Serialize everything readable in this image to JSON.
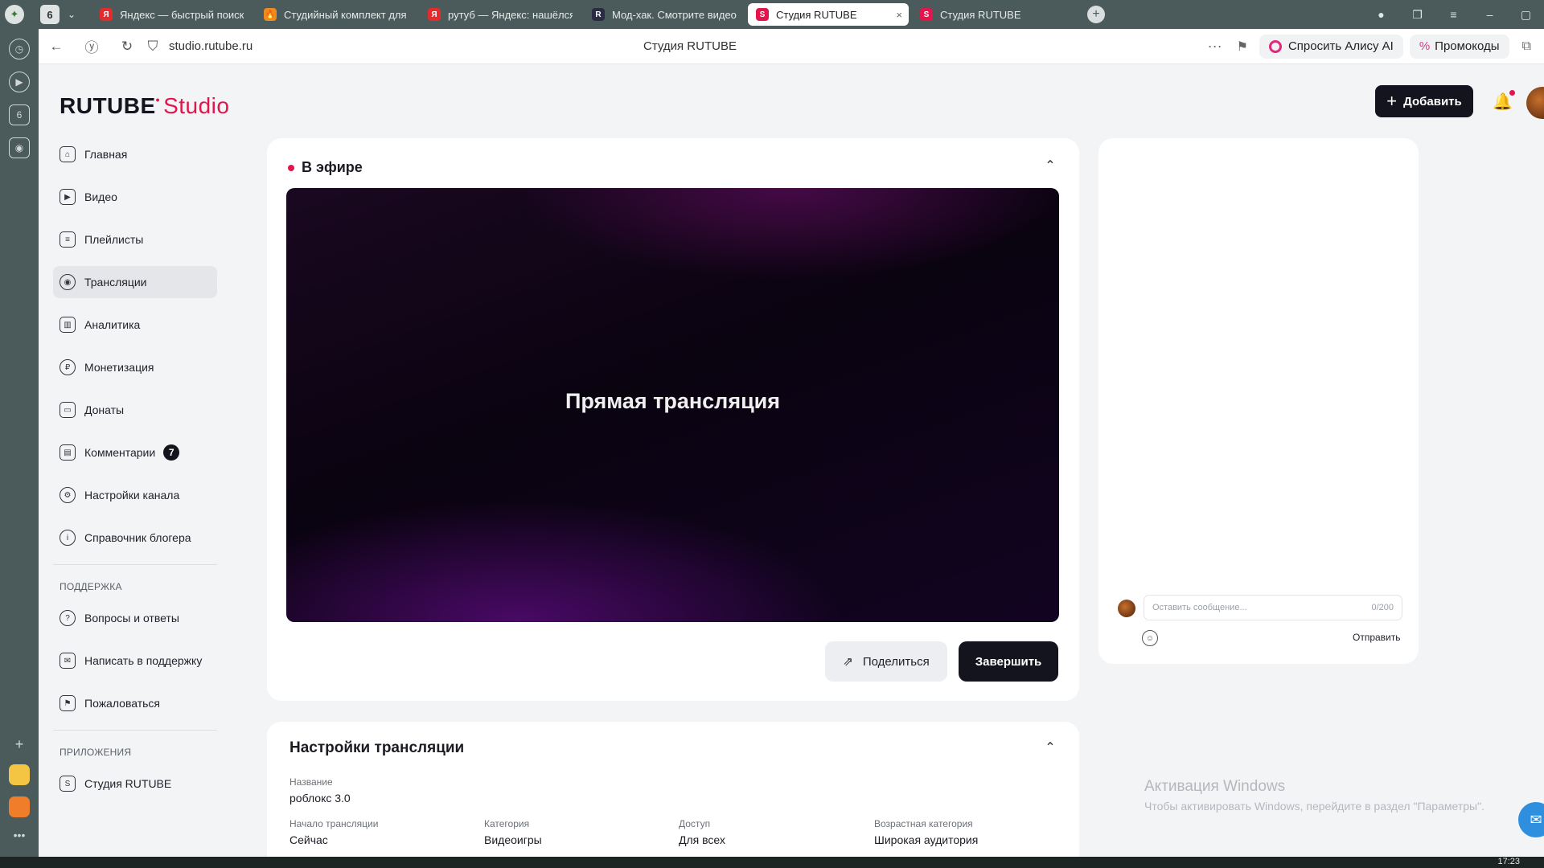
{
  "browser": {
    "tab_count": "6",
    "tabs": [
      {
        "label": "Яндекс — быстрый поиск",
        "fav": "Я",
        "color": "#e52b2b"
      },
      {
        "label": "Студийный комплект для",
        "fav": "🔥",
        "color": "#f08a1c"
      },
      {
        "label": "рутуб — Яндекс: нашёлся",
        "fav": "Я",
        "color": "#e52b2b"
      },
      {
        "label": "Мод-хак. Смотрите видео",
        "fav": "R",
        "color": "#2b2b44"
      },
      {
        "label": "Студия RUTUBE",
        "fav": "S",
        "color": "#e2154c",
        "active": true
      },
      {
        "label": "Студия RUTUBE",
        "fav": "S",
        "color": "#e2154c"
      }
    ],
    "url": "studio.rutube.ru",
    "page_title": "Студия RUTUBE",
    "alice_label": "Спросить Алису AI",
    "promo_label": "Промокоды",
    "sidebar_count": "6"
  },
  "header": {
    "brand_main": "RUTUBE",
    "brand_studio": "Studio",
    "add_label": "Добавить"
  },
  "nav": {
    "items": [
      {
        "label": "Главная",
        "icon": "home-icon"
      },
      {
        "label": "Видео",
        "icon": "video-icon"
      },
      {
        "label": "Плейлисты",
        "icon": "playlist-icon"
      },
      {
        "label": "Трансляции",
        "icon": "broadcast-icon",
        "active": true
      },
      {
        "label": "Аналитика",
        "icon": "analytics-icon"
      },
      {
        "label": "Монетизация",
        "icon": "ruble-icon"
      },
      {
        "label": "Донаты",
        "icon": "wallet-icon"
      },
      {
        "label": "Комментарии",
        "icon": "comment-icon",
        "count": "7"
      },
      {
        "label": "Настройки канала",
        "icon": "gear-icon"
      },
      {
        "label": "Справочник блогера",
        "icon": "info-icon"
      }
    ],
    "support_heading": "ПОДДЕРЖКА",
    "support_items": [
      {
        "label": "Вопросы и ответы",
        "icon": "question-icon"
      },
      {
        "label": "Написать в поддержку",
        "icon": "mail-icon"
      },
      {
        "label": "Пожаловаться",
        "icon": "flag-icon"
      }
    ],
    "apps_heading": "ПРИЛОЖЕНИЯ",
    "apps_items": [
      {
        "label": "Студия RUTUBE",
        "icon": "studio-app-icon"
      }
    ]
  },
  "live": {
    "status": "В эфире",
    "player_text": "Прямая трансляция",
    "share_label": "Поделиться",
    "end_label": "Завершить"
  },
  "settings": {
    "title": "Настройки трансляции",
    "name_label": "Название",
    "name_value": "роблокс 3.0",
    "start_label": "Начало трансляции",
    "start_value": "Сейчас",
    "category_label": "Категория",
    "category_value": "Видеоигры",
    "access_label": "Доступ",
    "access_value": "Для всех",
    "age_label": "Возрастная категория",
    "age_value": "Широкая аудитория"
  },
  "chat": {
    "placeholder": "Оставить сообщение...",
    "counter": "0/200",
    "send_label": "Отправить"
  },
  "windows": {
    "activation_title": "Активация Windows",
    "activation_text": "Чтобы активировать Windows, перейдите в раздел \"Параметры\".",
    "clock": "17:23"
  },
  "colors": {
    "accent": "#e2154c",
    "dark": "#14141e"
  }
}
